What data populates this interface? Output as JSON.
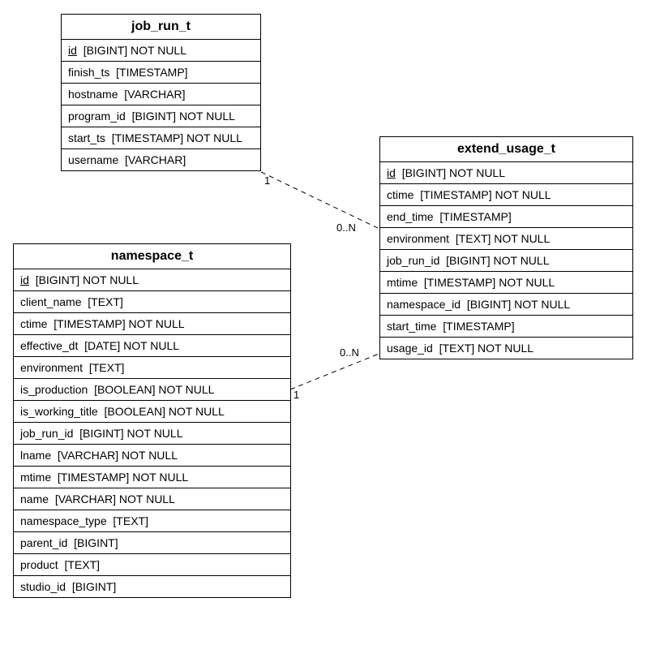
{
  "entities": {
    "job_run_t": {
      "title": "job_run_t",
      "columns": [
        {
          "name": "id",
          "type": "[BIGINT] NOT NULL",
          "pk": true
        },
        {
          "name": "finish_ts",
          "type": "[TIMESTAMP]"
        },
        {
          "name": "hostname",
          "type": "[VARCHAR]"
        },
        {
          "name": "program_id",
          "type": "[BIGINT] NOT NULL"
        },
        {
          "name": "start_ts",
          "type": "[TIMESTAMP] NOT NULL"
        },
        {
          "name": "username",
          "type": "[VARCHAR]"
        }
      ]
    },
    "namespace_t": {
      "title": "namespace_t",
      "columns": [
        {
          "name": "id",
          "type": "[BIGINT] NOT NULL",
          "pk": true
        },
        {
          "name": "client_name",
          "type": "[TEXT]"
        },
        {
          "name": "ctime",
          "type": "[TIMESTAMP] NOT NULL"
        },
        {
          "name": "effective_dt",
          "type": "[DATE] NOT NULL"
        },
        {
          "name": "environment",
          "type": "[TEXT]"
        },
        {
          "name": "is_production",
          "type": "[BOOLEAN] NOT NULL"
        },
        {
          "name": "is_working_title",
          "type": "[BOOLEAN] NOT NULL"
        },
        {
          "name": "job_run_id",
          "type": "[BIGINT] NOT NULL"
        },
        {
          "name": "lname",
          "type": "[VARCHAR] NOT NULL"
        },
        {
          "name": "mtime",
          "type": "[TIMESTAMP] NOT NULL"
        },
        {
          "name": "name",
          "type": "[VARCHAR] NOT NULL"
        },
        {
          "name": "namespace_type",
          "type": "[TEXT]"
        },
        {
          "name": "parent_id",
          "type": "[BIGINT]"
        },
        {
          "name": "product",
          "type": "[TEXT]"
        },
        {
          "name": "studio_id",
          "type": "[BIGINT]"
        }
      ]
    },
    "extend_usage_t": {
      "title": "extend_usage_t",
      "columns": [
        {
          "name": "id",
          "type": "[BIGINT] NOT NULL",
          "pk": true
        },
        {
          "name": "ctime",
          "type": "[TIMESTAMP] NOT NULL"
        },
        {
          "name": "end_time",
          "type": "[TIMESTAMP]"
        },
        {
          "name": "environment",
          "type": "[TEXT] NOT NULL"
        },
        {
          "name": "job_run_id",
          "type": "[BIGINT] NOT NULL"
        },
        {
          "name": "mtime",
          "type": "[TIMESTAMP] NOT NULL"
        },
        {
          "name": "namespace_id",
          "type": "[BIGINT] NOT NULL"
        },
        {
          "name": "start_time",
          "type": "[TIMESTAMP]"
        },
        {
          "name": "usage_id",
          "type": "[TEXT] NOT NULL"
        }
      ]
    }
  },
  "relationships": [
    {
      "from": "job_run_t",
      "from_card": "1",
      "to": "extend_usage_t",
      "to_card": "0..N"
    },
    {
      "from": "namespace_t",
      "from_card": "1",
      "to": "extend_usage_t",
      "to_card": "0..N"
    }
  ],
  "labels": {
    "rel1_left": "1",
    "rel1_right": "0..N",
    "rel2_left": "1",
    "rel2_right": "0..N"
  }
}
